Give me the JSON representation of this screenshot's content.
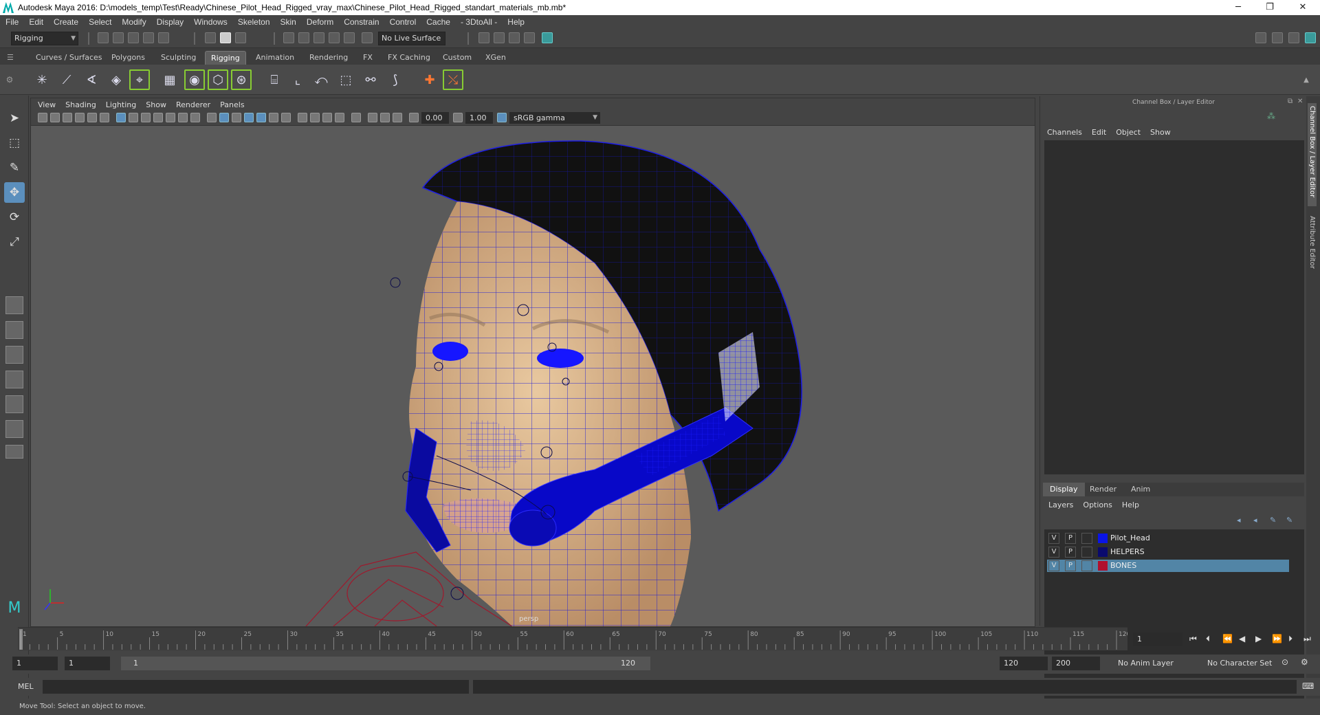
{
  "window": {
    "title": "Autodesk Maya 2016: D:\\models_temp\\Test\\Ready\\Chinese_Pilot_Head_Rigged_vray_max\\Chinese_Pilot_Head_Rigged_standart_materials_mb.mb*",
    "minimize": "─",
    "restore": "❐",
    "close": "✕"
  },
  "menus": [
    "File",
    "Edit",
    "Create",
    "Select",
    "Modify",
    "Display",
    "Windows",
    "Skeleton",
    "Skin",
    "Deform",
    "Constrain",
    "Control",
    "Cache",
    "- 3DtoAll -",
    "Help"
  ],
  "status": {
    "mode": "Rigging",
    "live_surface": "No Live Surface"
  },
  "shelf_tabs": [
    "Curves / Surfaces",
    "Polygons",
    "Sculpting",
    "Rigging",
    "Animation",
    "Rendering",
    "FX",
    "FX Caching",
    "Custom",
    "XGen"
  ],
  "active_shelf": "Rigging",
  "shelf_icons": [
    "joint-tool-icon",
    "ik-handle-icon",
    "ik-spline-icon",
    "insert-joint-icon",
    "locator-icon",
    "lattice-icon",
    "cluster-icon",
    "wrap-icon",
    "sculpt-deformer-icon",
    "bind-skin-icon",
    "paint-weights-icon",
    "mirror-weights-icon",
    "copy-weights-icon",
    "edit-influences-icon",
    "muscle-icon",
    "point-constraint-icon",
    "aim-constraint-icon",
    "orient-constraint-icon"
  ],
  "viewport": {
    "menus": [
      "View",
      "Shading",
      "Lighting",
      "Show",
      "Renderer",
      "Panels"
    ],
    "exposure": "0.00",
    "gamma": "1.00",
    "color_space": "sRGB gamma",
    "camera": "persp"
  },
  "channel_box": {
    "title": "Channel Box / Layer Editor",
    "menus": [
      "Channels",
      "Edit",
      "Object",
      "Show"
    ]
  },
  "layer_editor": {
    "tabs": [
      "Display",
      "Render",
      "Anim"
    ],
    "active_tab": "Display",
    "menus": [
      "Layers",
      "Options",
      "Help"
    ],
    "layers": [
      {
        "v": "V",
        "p": "P",
        "color": "#0a14e6",
        "name": "Pilot_Head",
        "selected": false
      },
      {
        "v": "V",
        "p": "P",
        "color": "#0a0a6e",
        "name": "HELPERS",
        "selected": false
      },
      {
        "v": "V",
        "p": "P",
        "color": "#b0102e",
        "name": "BONES",
        "selected": true
      }
    ]
  },
  "side_tabs": [
    "Channel Box / Layer Editor",
    "Attribute Editor"
  ],
  "timeline": {
    "labels": [
      "1",
      "5",
      "10",
      "15",
      "20",
      "25",
      "30",
      "35",
      "40",
      "45",
      "50",
      "55",
      "60",
      "65",
      "70",
      "75",
      "80",
      "85",
      "90",
      "95",
      "100",
      "105",
      "110",
      "115",
      "120"
    ],
    "current_frame": "1"
  },
  "range": {
    "start": "1",
    "anim_start": "1",
    "slider_start": "1",
    "slider_end": "120",
    "anim_end": "120",
    "end": "200",
    "anim_layer": "No Anim Layer",
    "character_set": "No Character Set"
  },
  "command": {
    "label": "MEL"
  },
  "help_line": "Move Tool: Select an object to move."
}
